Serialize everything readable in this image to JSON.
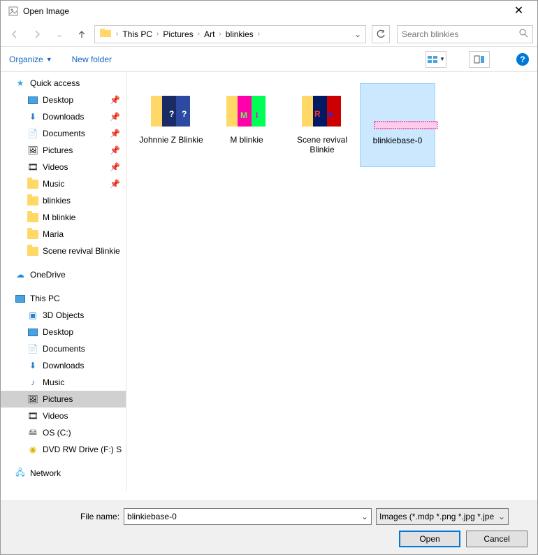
{
  "window": {
    "title": "Open Image"
  },
  "breadcrumbs": {
    "root": "This PC",
    "p1": "Pictures",
    "p2": "Art",
    "p3": "blinkies"
  },
  "search": {
    "placeholder": "Search blinkies"
  },
  "toolbar": {
    "organize": "Organize",
    "newfolder": "New folder"
  },
  "tree": {
    "quick": "Quick access",
    "desktop": "Desktop",
    "downloads": "Downloads",
    "documents": "Documents",
    "pictures": "Pictures",
    "videos": "Videos",
    "music": "Music",
    "blinkies": "blinkies",
    "mblinkie": "M blinkie",
    "maria": "Maria",
    "scene": "Scene revival Blinkie",
    "onedrive": "OneDrive",
    "thispc": "This PC",
    "threed": "3D Objects",
    "desktop2": "Desktop",
    "documents2": "Documents",
    "downloads2": "Downloads",
    "music2": "Music",
    "pictures2": "Pictures",
    "videos2": "Videos",
    "osc": "OS (C:)",
    "dvd": "DVD RW Drive (F:) S",
    "network": "Network"
  },
  "files": {
    "f0": "Johnnie Z Blinkie",
    "f1": "M blinkie",
    "f2": "Scene revival Blinkie",
    "f3": "blinkiebase-0"
  },
  "bottom": {
    "label": "File name:",
    "value": "blinkiebase-0",
    "filter": "Images (*.mdp *.png *.jpg *.jpe",
    "open": "Open",
    "cancel": "Cancel"
  }
}
